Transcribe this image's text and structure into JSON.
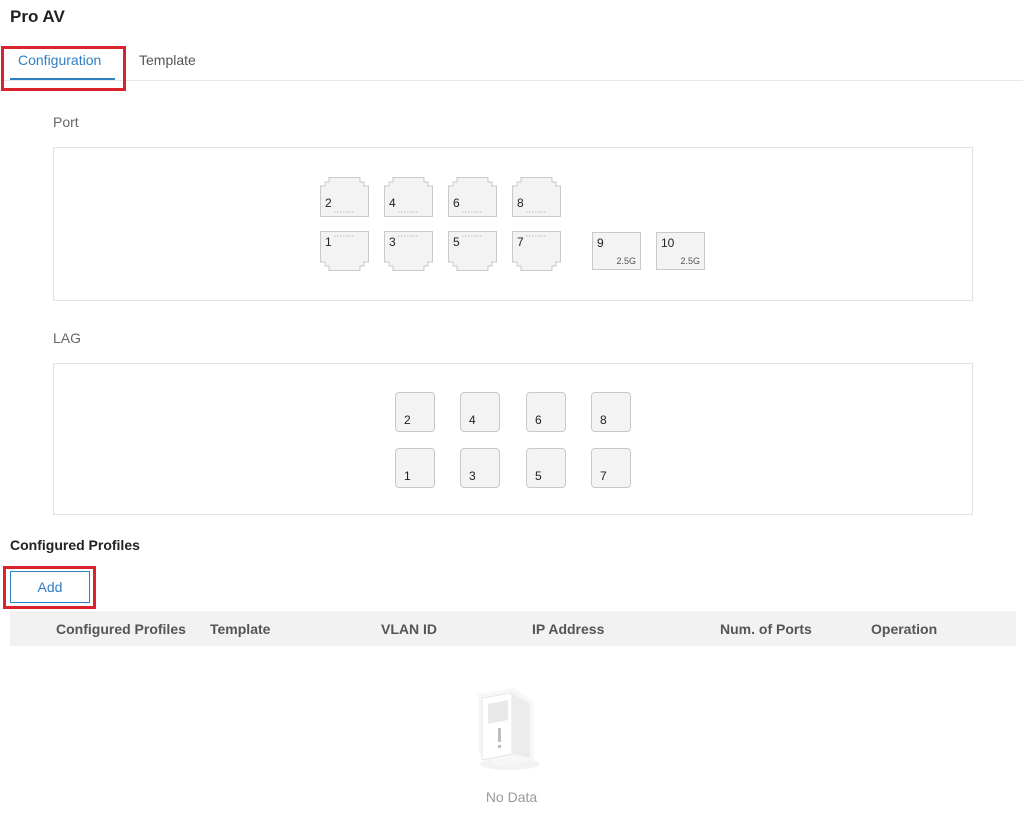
{
  "page": {
    "title": "Pro AV"
  },
  "tabs": [
    {
      "label": "Configuration",
      "active": true
    },
    {
      "label": "Template",
      "active": false
    }
  ],
  "port_section": {
    "label": "Port",
    "top_row": [
      "2",
      "4",
      "6",
      "8"
    ],
    "bottom_row": [
      "1",
      "3",
      "5",
      "7"
    ],
    "sfp_ports": [
      {
        "number": "9",
        "speed": "2.5G"
      },
      {
        "number": "10",
        "speed": "2.5G"
      }
    ]
  },
  "lag_section": {
    "label": "LAG",
    "top_row": [
      "2",
      "4",
      "6",
      "8"
    ],
    "bottom_row": [
      "1",
      "3",
      "5",
      "7"
    ]
  },
  "profiles": {
    "title": "Configured Profiles",
    "add_label": "Add",
    "columns": [
      "Configured Profiles",
      "Template",
      "VLAN ID",
      "IP Address",
      "Num. of Ports",
      "Operation"
    ],
    "rows": [],
    "empty_text": "No Data"
  },
  "colors": {
    "accent": "#2e7fc4",
    "highlight": "#d9232d"
  }
}
